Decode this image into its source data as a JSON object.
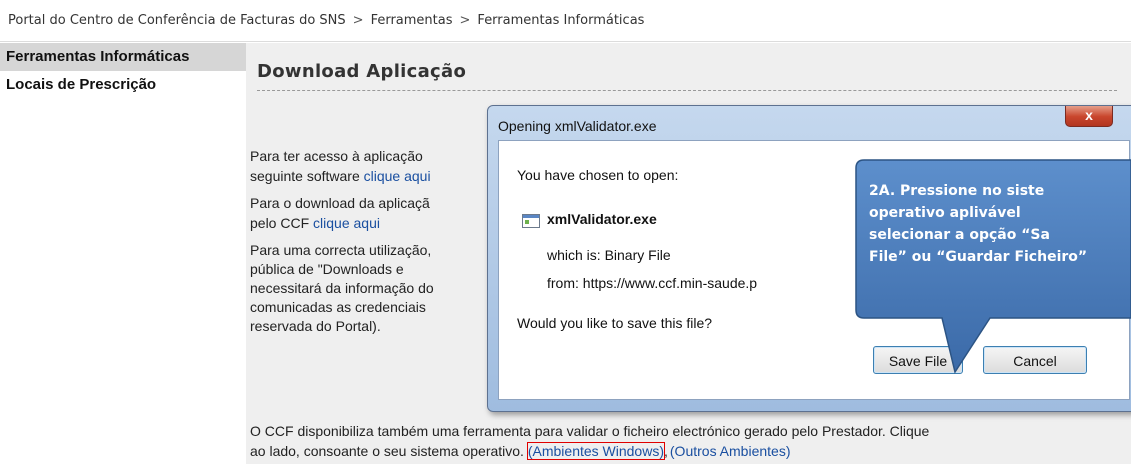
{
  "breadcrumb": {
    "items": [
      "Portal do Centro de Conferência de Facturas do SNS",
      "Ferramentas",
      "Ferramentas Informáticas"
    ],
    "separator": ">"
  },
  "sidebar": {
    "items": [
      {
        "label": "Ferramentas Informáticas",
        "active": true
      },
      {
        "label": "Locais de Prescrição",
        "active": false
      }
    ]
  },
  "main": {
    "title": "Download Aplicação",
    "paragraphs": {
      "p1_line1": "Para ter acesso à aplicação",
      "p1_line2_text": "seguinte software ",
      "p1_line2_link": "clique aqui",
      "p2_line1": "Para o download da aplicaçã",
      "p2_line2_text": "pelo CCF ",
      "p2_line2_link": "clique aqui",
      "p3_line1": "Para uma correcta utilização,",
      "p3_line2": "pública de \"Downloads e",
      "p3_line3": "necessitará da informação do",
      "p3_line4": "comunicadas as credenciais",
      "p3_line5": "reservada do Portal).",
      "p4_line1": "O CCF disponibiliza também uma ferramenta para validar o ficheiro electrónico gerado pelo Prestador. Clique",
      "p4_line2_text": "ao lado, consoante o seu sistema operativo. ",
      "p4_link_windows": "(Ambientes Windows)",
      "p4_comma": ",",
      "p4_link_other": "(Outros Ambientes)"
    }
  },
  "dialog": {
    "title": "Opening xmlValidator.exe",
    "close_label": "x",
    "chosen_text": "You have chosen to open:",
    "file_name": "xmlValidator.exe",
    "which_is": "which is:  Binary File",
    "from": "from:  https://www.ccf.min-saude.p",
    "question": "Would you like to save this file?",
    "save_label": "Save File",
    "cancel_label": "Cancel"
  },
  "callout": {
    "line1": "2A.  Pressione  no  siste",
    "line2": "operativo      aplivável",
    "line3": "selecionar  a  opção  “Sa",
    "line4": "File” ou “Guardar Ficheiro”",
    "color": "#4f81bd"
  },
  "colors": {
    "link": "#1a4fa0",
    "highlight_box": "#e00000",
    "sidebar_active": "#d6d6d6",
    "main_bg": "#efefef"
  }
}
